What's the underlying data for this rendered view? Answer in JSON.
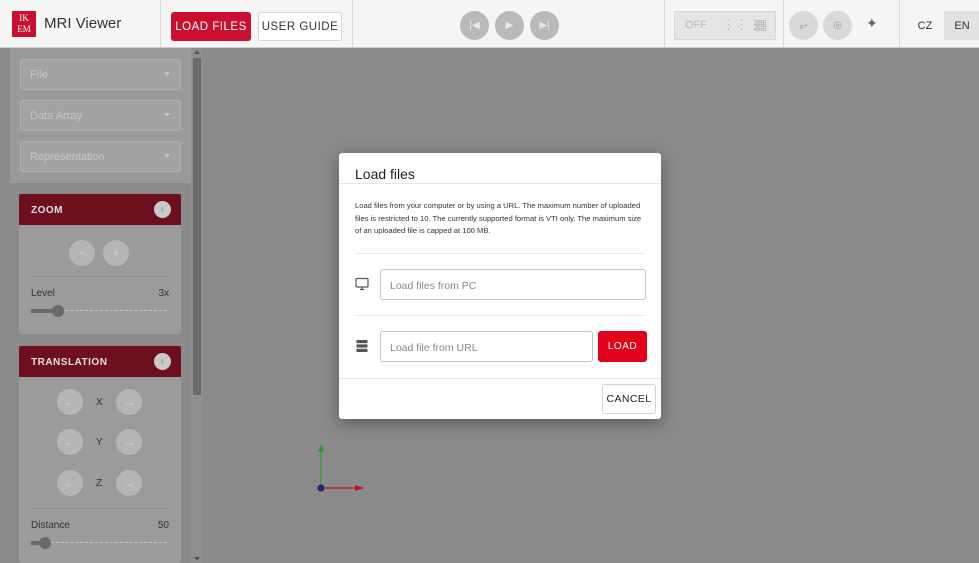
{
  "app": {
    "logo_text": "IKEM",
    "title": "MRI Viewer"
  },
  "toolbar": {
    "load_files_label": "LOAD FILES",
    "user_guide_label": "USER GUIDE",
    "grid_off_label": "OFF",
    "lang_cz": "CZ",
    "lang_en": "EN",
    "icons": [
      "skip-previous-icon",
      "play-icon",
      "skip-next-icon",
      "dots-grid-icon",
      "grid-icon",
      "axes-3d-icon",
      "focus-icon",
      "wand-icon"
    ]
  },
  "sidebar": {
    "file_placeholder": "File",
    "data_array_placeholder": "Data Array",
    "representation_placeholder": "Representation",
    "zoom": {
      "title": "ZOOM",
      "info": "i",
      "level_label": "Level",
      "level_value": "3x",
      "slider_fraction": 0.2
    },
    "translation": {
      "title": "TRANSLATION",
      "info": "i",
      "axes": [
        "X",
        "Y",
        "Z"
      ],
      "distance_label": "Distance",
      "distance_value": "50",
      "slider_fraction": 0.1
    }
  },
  "dialog": {
    "title": "Load files",
    "description": "Load files from your computer or by using a URL. The maximum number of uploaded files is restricted to 10. The currently supported format is VTI only. The maximum size of an uploaded file is capped at 100 MB.",
    "pc_placeholder": "Load files from PC",
    "url_placeholder": "Load file from URL",
    "load_label": "LOAD",
    "cancel_label": "CANCEL"
  },
  "colors": {
    "brand": "#c8102e",
    "load_button": "#e3001b",
    "axis_y": "#2e9e2e",
    "axis_x": "#b51a1a",
    "axis_origin": "#1a237e"
  }
}
